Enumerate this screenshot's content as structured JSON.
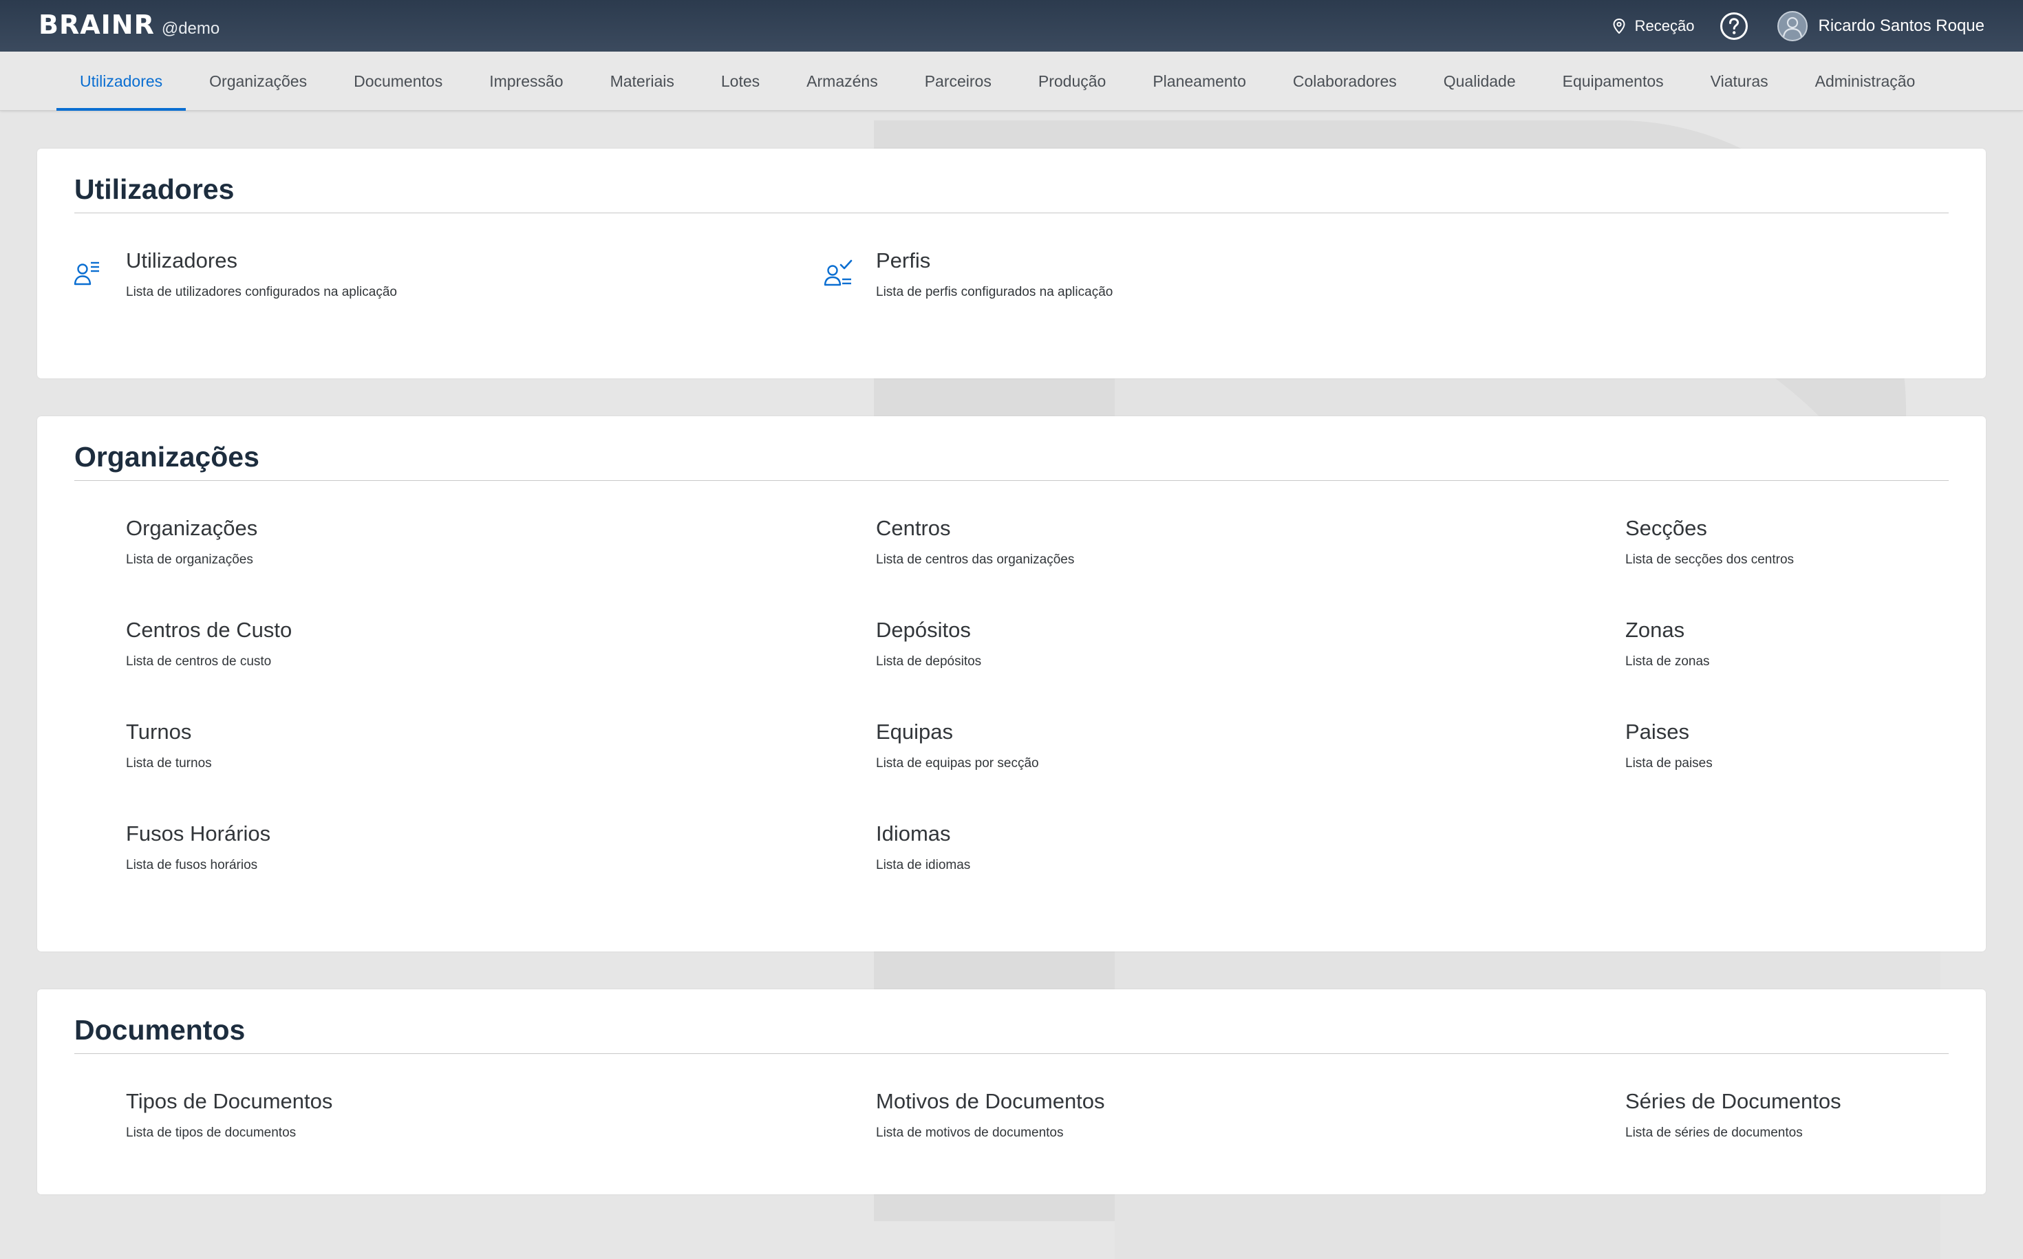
{
  "shell": {
    "brand": "BRAINR",
    "tenant": "@demo",
    "location": "Receção",
    "user_name": "Ricardo Santos Roque",
    "accent": "#0a6ed1"
  },
  "tabs": [
    {
      "label": "Utilizadores",
      "active": true
    },
    {
      "label": "Organizações"
    },
    {
      "label": "Documentos"
    },
    {
      "label": "Impressão"
    },
    {
      "label": "Materiais"
    },
    {
      "label": "Lotes"
    },
    {
      "label": "Armazéns"
    },
    {
      "label": "Parceiros"
    },
    {
      "label": "Produção"
    },
    {
      "label": "Planeamento"
    },
    {
      "label": "Colaboradores"
    },
    {
      "label": "Qualidade"
    },
    {
      "label": "Equipamentos"
    },
    {
      "label": "Viaturas"
    },
    {
      "label": "Administração"
    }
  ],
  "sections": {
    "utilizadores": {
      "title": "Utilizadores",
      "items": [
        {
          "title": "Utilizadores",
          "desc": "Lista de utilizadores configurados na aplicação",
          "icon": "user-list-icon"
        },
        {
          "title": "Perfis",
          "desc": "Lista de perfis configurados na aplicação",
          "icon": "user-check-icon"
        }
      ]
    },
    "organizacoes": {
      "title": "Organizações",
      "items": [
        {
          "title": "Organizações",
          "desc": "Lista de organizações"
        },
        {
          "title": "Centros",
          "desc": "Lista de centros das organizações"
        },
        {
          "title": "Secções",
          "desc": "Lista de secções dos centros"
        },
        {
          "title": "Centros de Custo",
          "desc": "Lista de centros de custo"
        },
        {
          "title": "Depósitos",
          "desc": "Lista de depósitos"
        },
        {
          "title": "Zonas",
          "desc": "Lista de zonas"
        },
        {
          "title": "Turnos",
          "desc": "Lista de turnos"
        },
        {
          "title": "Equipas",
          "desc": "Lista de equipas por secção"
        },
        {
          "title": "Paises",
          "desc": "Lista de paises"
        },
        {
          "title": "Fusos Horários",
          "desc": "Lista de fusos horários"
        },
        {
          "title": "Idiomas",
          "desc": "Lista de idiomas"
        }
      ]
    },
    "documentos": {
      "title": "Documentos",
      "items": [
        {
          "title": "Tipos de Documentos",
          "desc": "Lista de tipos de documentos"
        },
        {
          "title": "Motivos de Documentos",
          "desc": "Lista de motivos de documentos"
        },
        {
          "title": "Séries de Documentos",
          "desc": "Lista de séries de documentos"
        }
      ]
    }
  }
}
